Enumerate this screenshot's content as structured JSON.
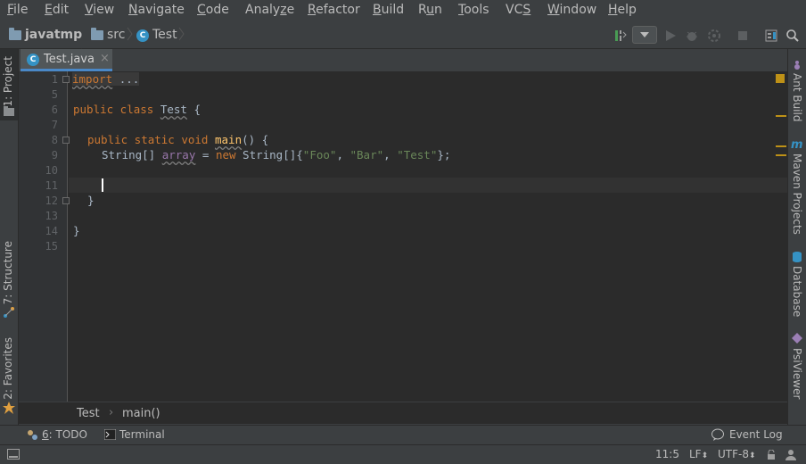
{
  "menubar": {
    "items": [
      {
        "mn": "F",
        "rest": "ile"
      },
      {
        "mn": "E",
        "rest": "dit"
      },
      {
        "mn": "V",
        "rest": "iew"
      },
      {
        "mn": "N",
        "rest": "avigate"
      },
      {
        "mn": "C",
        "rest": "ode"
      },
      {
        "pre": "Analy",
        "mn": "z",
        "rest": "e"
      },
      {
        "mn": "R",
        "rest": "efactor"
      },
      {
        "mn": "B",
        "rest": "uild"
      },
      {
        "pre": "R",
        "mn": "u",
        "rest": "n"
      },
      {
        "mn": "T",
        "rest": "ools"
      },
      {
        "pre": "VC",
        "mn": "S",
        "rest": ""
      },
      {
        "mn": "W",
        "rest": "indow"
      },
      {
        "mn": "H",
        "rest": "elp"
      }
    ]
  },
  "navbar": {
    "project": "javatmp",
    "folder": "src",
    "class_icon": "C",
    "class_name": "Test"
  },
  "tab": {
    "icon": "C",
    "label": "Test.java",
    "close": "×"
  },
  "left_strip": {
    "project_label": "1: Project",
    "structure_label": "7: Structure",
    "favorites_label": "2: Favorites"
  },
  "right_strip": {
    "ant_label": "Ant Build",
    "maven_label": "Maven Projects",
    "database_label": "Database",
    "psi_label": "PsiViewer"
  },
  "editor": {
    "line_numbers": [
      "1",
      "5",
      "6",
      "7",
      "8",
      "9",
      "10",
      "11",
      "12",
      "13",
      "14",
      "15"
    ],
    "import_kw": "import",
    "import_fold": "...",
    "class_decl": {
      "kw": "public class ",
      "name": "Test",
      "rest": " {"
    },
    "main_decl": {
      "kw": "public static void ",
      "name": "main",
      "rest": "() {"
    },
    "array_line": {
      "type": "String[] ",
      "var": "array",
      "eq": " = ",
      "kw": "new",
      "type2": " String[]{",
      "s1": "\"Foo\"",
      "c1": ", ",
      "s2": "\"Bar\"",
      "c2": ", ",
      "s3": "\"Test\"",
      "end": "};"
    },
    "close_inner": "}",
    "close_outer": "}"
  },
  "breadcrumb": {
    "class": "Test",
    "sep": "›",
    "method": "main()"
  },
  "toolwindows": {
    "todo_num": "6",
    "todo_label": ": TODO",
    "terminal": "Terminal",
    "event_log": "Event Log"
  },
  "status": {
    "position": "11:5",
    "line_sep": "LF",
    "encoding": "UTF-8"
  },
  "colors": {
    "accent": "#4a88c7",
    "keyword": "#cc7832",
    "string": "#6a8759",
    "warning": "#be9117"
  }
}
